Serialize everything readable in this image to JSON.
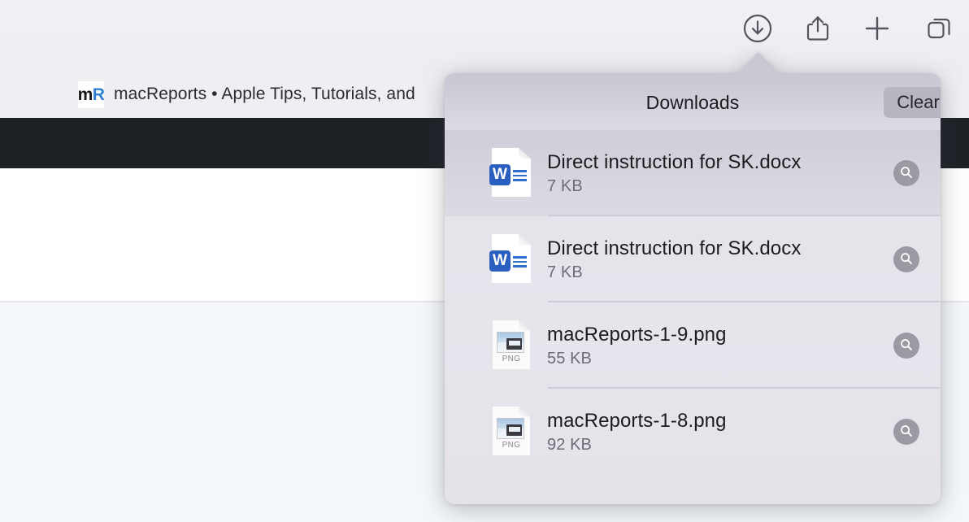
{
  "browser": {
    "tab": {
      "favicon_letter_1": "m",
      "favicon_letter_2": "R",
      "favicon_name": "macreports-favicon",
      "title": "macReports • Apple Tips, Tutorials, and"
    },
    "toolbar": {
      "downloads_label": "Downloads",
      "share_label": "Share",
      "new_tab_label": "New Tab",
      "tab_overview_label": "Tab Overview",
      "icons": [
        "downloads-icon",
        "share-icon",
        "plus-icon",
        "tab-overview-icon"
      ]
    }
  },
  "popover": {
    "title": "Downloads",
    "clear_label": "Clear",
    "items": [
      {
        "name": "Direct instruction for SK.docx",
        "size": "7 KB",
        "kind": "docx",
        "icon": "word-document-icon",
        "badge": "W",
        "selected": true,
        "reveal_icon": "magnifier-icon"
      },
      {
        "name": "Direct instruction for SK.docx",
        "size": "7 KB",
        "kind": "docx",
        "icon": "word-document-icon",
        "badge": "W",
        "selected": false,
        "reveal_icon": "magnifier-icon"
      },
      {
        "name": "macReports-1-9.png",
        "size": "55 KB",
        "kind": "png",
        "icon": "png-image-icon",
        "badge": "PNG",
        "selected": false,
        "reveal_icon": "magnifier-icon"
      },
      {
        "name": "macReports-1-8.png",
        "size": "92 KB",
        "kind": "png",
        "icon": "png-image-icon",
        "badge": "PNG",
        "selected": false,
        "reveal_icon": "magnifier-icon"
      }
    ]
  },
  "colors": {
    "toolbar_bg": "#f0eef2",
    "site_navbar": "#1e2227",
    "site_body": "#ffffff",
    "site_lower": "#f4f8fb",
    "popover_bg": "#e7e5ec",
    "clear_button_bg": "#b7b6c0",
    "filename_text": "#1c1c1e",
    "filesize_text": "#6d6d76",
    "word_blue": "#2a5fbf",
    "favicon_blue": "#2f7fd0",
    "reveal_button_bg": "#9a9aa3"
  }
}
